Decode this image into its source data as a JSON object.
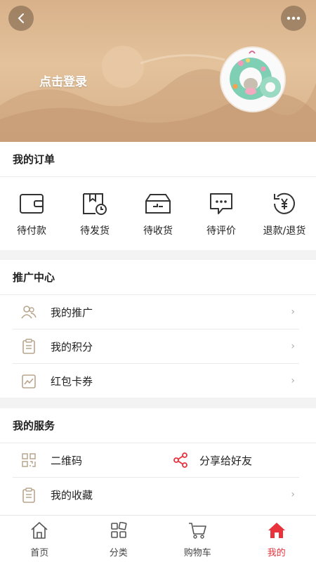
{
  "header": {
    "back_icon": "chevron-left-icon",
    "more_icon": "more-dots-icon",
    "login_text": "点击登录",
    "avatar": "plush-wreath-avatar"
  },
  "orders": {
    "title": "我的订单",
    "items": [
      {
        "label": "待付款",
        "icon": "wallet-icon"
      },
      {
        "label": "待发货",
        "icon": "package-clock-icon"
      },
      {
        "label": "待收货",
        "icon": "box-receive-icon"
      },
      {
        "label": "待评价",
        "icon": "chat-bubble-icon"
      },
      {
        "label": "退款/退货",
        "icon": "refund-yen-icon"
      }
    ]
  },
  "promo": {
    "title": "推广中心",
    "items": [
      {
        "label": "我的推广",
        "icon": "users-icon"
      },
      {
        "label": "我的积分",
        "icon": "clipboard-icon"
      },
      {
        "label": "红包卡券",
        "icon": "trend-chart-icon"
      }
    ],
    "chevron": "›"
  },
  "services": {
    "title": "我的服务",
    "qr_label": "二维码",
    "share_label": "分享给好友",
    "favorites_label": "我的收藏",
    "chevron": "›"
  },
  "tabbar": {
    "items": [
      {
        "label": "首页",
        "icon": "home-icon",
        "active": false
      },
      {
        "label": "分类",
        "icon": "grid-icon",
        "active": false
      },
      {
        "label": "购物车",
        "icon": "cart-icon",
        "active": false
      },
      {
        "label": "我的",
        "icon": "home-filled-icon",
        "active": true
      }
    ],
    "active_color": "#e8323c"
  }
}
